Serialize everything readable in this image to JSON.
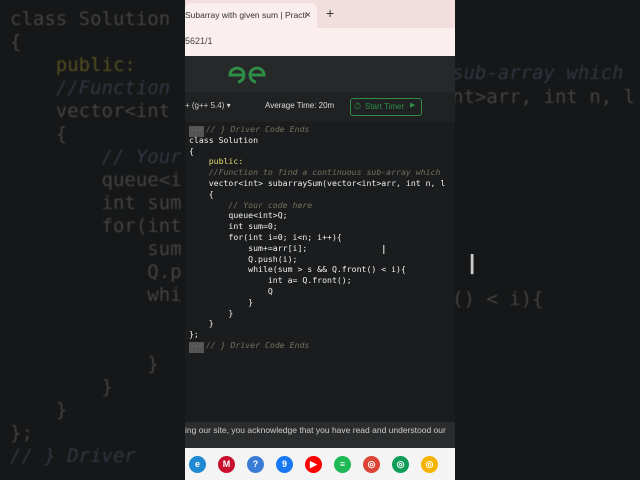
{
  "browser": {
    "tab_title": "Subarray with given sum | Practi",
    "tab_close": "×",
    "new_tab": "+",
    "url_fragment": "5621/1"
  },
  "site": {
    "logo_text": "GG",
    "language": "+ (g++ 5.4)",
    "language_chevron": "▾",
    "average_time": "Average Time: 20m",
    "start_timer": "Start Timer",
    "timer_icon": "stopwatch-icon",
    "play_icon": "play-icon"
  },
  "editor": {
    "lines": [
      {
        "fold": "···",
        "text": "// } Driver Code Ends",
        "kind": "comment"
      },
      {
        "text": "class Solution",
        "kind": "code"
      },
      {
        "text": "{",
        "kind": "code"
      },
      {
        "text": "    public:",
        "kind": "keyword"
      },
      {
        "text": "    //Function to find a continuous sub-array which",
        "kind": "comment"
      },
      {
        "text": "    vector<int> subarraySum(vector<int>arr, int n, l",
        "kind": "code"
      },
      {
        "text": "    {",
        "kind": "code"
      },
      {
        "text": "        // Your code here",
        "kind": "comment"
      },
      {
        "text": "        queue<int>Q;",
        "kind": "code"
      },
      {
        "text": "        int sum=0;",
        "kind": "code"
      },
      {
        "text": "        for(int i=0; i<n; i++){",
        "kind": "code"
      },
      {
        "text": "            sum+=arr[i];",
        "kind": "code"
      },
      {
        "text": "            Q.push(i);",
        "kind": "code"
      },
      {
        "text": "            while(sum > s && Q.front() < i){",
        "kind": "code"
      },
      {
        "text": "                int a= Q.front();",
        "kind": "code"
      },
      {
        "text": "                Q",
        "kind": "code"
      },
      {
        "text": "            }",
        "kind": "code"
      },
      {
        "text": "        }",
        "kind": "code"
      },
      {
        "text": "    }",
        "kind": "code"
      },
      {
        "text": "};",
        "kind": "code"
      },
      {
        "fold": "···",
        "text": "// } Driver Code Ends",
        "kind": "comment"
      }
    ]
  },
  "notice": "ing our site, you acknowledge that you have read and understood our",
  "background_code": [
    {
      "text": "class Solution",
      "kind": "code"
    },
    {
      "text": "{",
      "kind": "code"
    },
    {
      "text": "    public:",
      "kind": "keyword"
    },
    {
      "text": "    //Function",
      "kind": "comment"
    },
    {
      "text": "    vector<int",
      "kind": "code"
    },
    {
      "text": "    {",
      "kind": "code"
    },
    {
      "text": "        // Your",
      "kind": "comment"
    },
    {
      "text": "        queue<i",
      "kind": "code"
    },
    {
      "text": "        int sum",
      "kind": "code"
    },
    {
      "text": "        for(int",
      "kind": "code"
    },
    {
      "text": "            sum",
      "kind": "code"
    },
    {
      "text": "            Q.p",
      "kind": "code"
    },
    {
      "text": "            whi",
      "kind": "code"
    },
    {
      "text": "",
      "kind": "code"
    },
    {
      "text": "",
      "kind": "code"
    },
    {
      "text": "            }",
      "kind": "code"
    },
    {
      "text": "        }",
      "kind": "code"
    },
    {
      "text": "    }",
      "kind": "code"
    },
    {
      "text": "};",
      "kind": "code"
    },
    {
      "text": "// } Driver",
      "kind": "comment"
    }
  ],
  "background_right": [
    {
      "text": "sub-array which",
      "kind": "comment"
    },
    {
      "text": "nt>arr, int n, l",
      "kind": "code"
    },
    {
      "text": "() < i){",
      "kind": "code"
    }
  ],
  "taskbar_icons": [
    {
      "name": "edge-icon",
      "color": "#1f8ad2",
      "label": "e"
    },
    {
      "name": "mcafee-icon",
      "color": "#c8102e",
      "label": "M"
    },
    {
      "name": "copilot-icon",
      "color": "#3a7bd5",
      "label": "?"
    },
    {
      "name": "messenger-icon",
      "color": "#1877f2",
      "label": "9"
    },
    {
      "name": "youtube-icon",
      "color": "#ff0000",
      "label": "▶"
    },
    {
      "name": "spotify-icon",
      "color": "#1db954",
      "label": "≡"
    },
    {
      "name": "chrome-icon",
      "color": "#db4437",
      "label": "◎"
    },
    {
      "name": "chrome-icon-2",
      "color": "#0f9d58",
      "label": "◎"
    },
    {
      "name": "chrome-icon-3",
      "color": "#f4b400",
      "label": "◎"
    }
  ]
}
